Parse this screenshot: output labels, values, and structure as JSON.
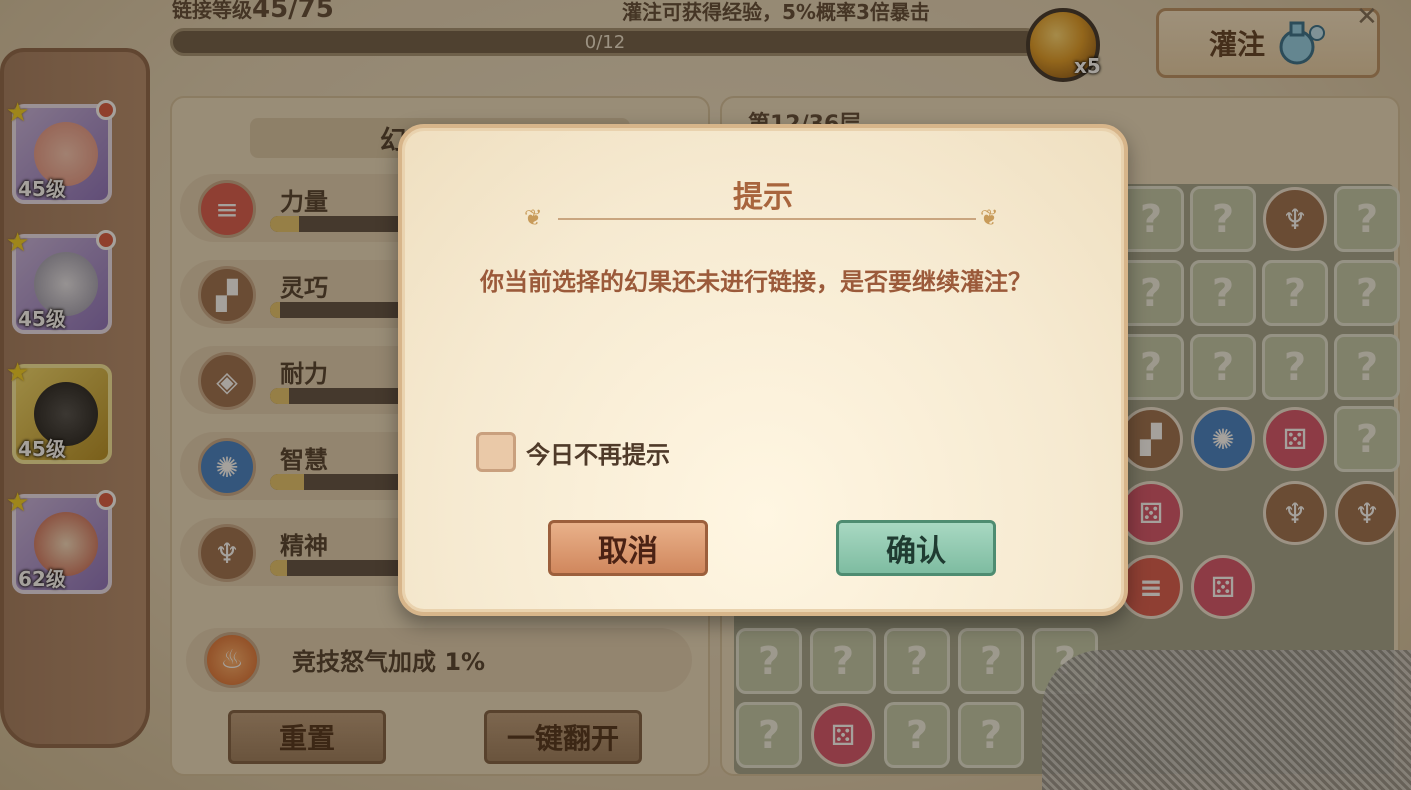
{
  "top": {
    "link_level_label": "链接等级",
    "link_level_value": "45/75",
    "inject_tip": "灌注可获得经验，5%概率3倍暴击",
    "exp_progress": "0/12",
    "orb_count": "x5",
    "inject_button": "灌注",
    "close_icon": "close-icon"
  },
  "heroes": [
    {
      "level": "45级",
      "selected": false
    },
    {
      "level": "45级",
      "selected": false
    },
    {
      "level": "45级",
      "selected": true
    },
    {
      "level": "62级",
      "selected": false
    }
  ],
  "stats": {
    "header": "幻",
    "items": [
      {
        "name": "力量",
        "icon": "dumbbell-icon",
        "color": "#d9574a",
        "fill": 0.12
      },
      {
        "name": "灵巧",
        "icon": "boot-icon",
        "color": "#9a6d4d",
        "fill": 0.04
      },
      {
        "name": "耐力",
        "icon": "shield-icon",
        "color": "#9a6d4d",
        "fill": 0.08
      },
      {
        "name": "智慧",
        "icon": "sun-icon",
        "color": "#3d7fc9",
        "fill": 0.14
      },
      {
        "name": "精神",
        "icon": "spirit-icon",
        "color": "#9a6d4d",
        "fill": 0.07
      }
    ],
    "arena_bonus": "竞技怒气加成 1%",
    "reset_button": "重置",
    "flip_all_button": "一键翻开"
  },
  "grid": {
    "floor_label": "第12/36层",
    "unknown_glyph": "?"
  },
  "dialog": {
    "title": "提示",
    "message": "你当前选择的幻果还未进行链接，是否要继续灌注？",
    "checkbox_label": "今日不再提示",
    "cancel_button": "取消",
    "confirm_button": "确认"
  }
}
